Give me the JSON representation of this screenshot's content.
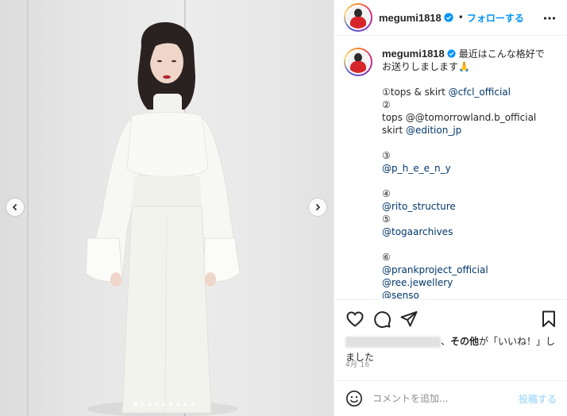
{
  "post": {
    "username": "megumi1818",
    "follow_label": "フォローする",
    "separator": "•",
    "image_count": 9,
    "active_image": 0
  },
  "caption": {
    "username": "megumi1818",
    "lines": [
      {
        "text": "最近はこんな格好で",
        "mention": false,
        "inline_with_user": true
      },
      {
        "text": "お送りしまします🙏",
        "mention": false
      },
      {
        "text": "",
        "mention": false
      },
      {
        "text": "①tops & skirt ",
        "mention": false,
        "suffix": "@cfcl_official"
      },
      {
        "text": "②",
        "mention": false
      },
      {
        "text": "tops @@tomorrowland.b_official",
        "mention": false
      },
      {
        "text": "skirt ",
        "mention": false,
        "suffix": "@edition_jp"
      },
      {
        "text": "",
        "mention": false
      },
      {
        "text": "③",
        "mention": false
      },
      {
        "text": "@p_h_e_e_n_y",
        "mention": true
      },
      {
        "text": "",
        "mention": false
      },
      {
        "text": "④",
        "mention": false
      },
      {
        "text": "@rito_structure",
        "mention": true
      },
      {
        "text": "⑤",
        "mention": false
      },
      {
        "text": "@togaarchives",
        "mention": true
      },
      {
        "text": "",
        "mention": false
      },
      {
        "text": "⑥",
        "mention": false
      },
      {
        "text": "@prankproject_official",
        "mention": true
      },
      {
        "text": "@ree.jewellery",
        "mention": true
      },
      {
        "text": "@senso",
        "mention": true
      }
    ]
  },
  "likes": {
    "middle": "、",
    "others_label": "その他",
    "suffix_1": "が「いいね！」し",
    "suffix_2": "ました"
  },
  "date": "4月 16",
  "comment": {
    "placeholder": "コメントを追加...",
    "post_label": "投稿する"
  },
  "icons": {
    "like": "heart-icon",
    "comment": "comment-icon",
    "share": "paper-plane-icon",
    "save": "bookmark-icon",
    "emoji": "smiley-icon",
    "more": "more-options-icon",
    "verified": "verified-badge-icon",
    "prev": "chevron-left-icon",
    "next": "chevron-right-icon"
  },
  "colors": {
    "link_blue": "#0095f6",
    "mention_blue": "#00376b",
    "post_disabled": "#b2dffc",
    "muted": "#8e8e8e"
  }
}
